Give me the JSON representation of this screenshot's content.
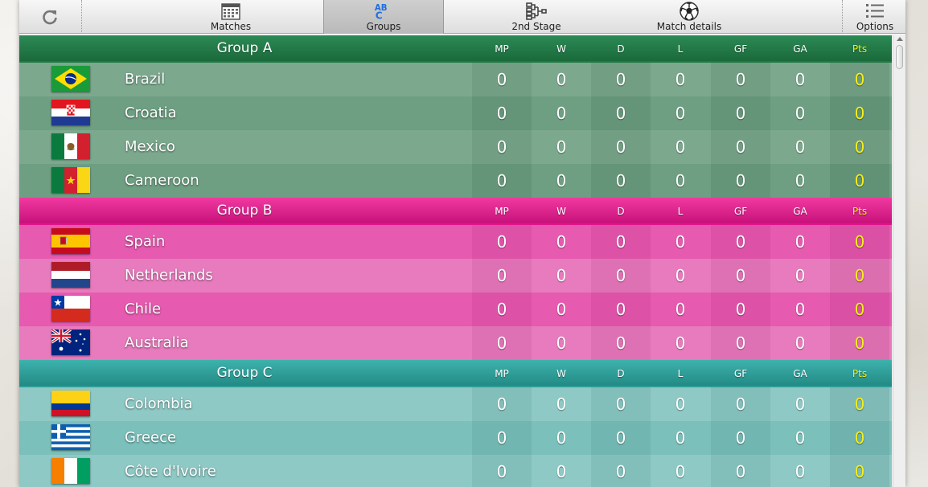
{
  "toolbar": {
    "items": [
      {
        "label": "",
        "icon": "refresh-icon"
      },
      {
        "label": "Matches",
        "icon": "calendar-icon"
      },
      {
        "label": "Groups",
        "icon": "abc-icon"
      },
      {
        "label": "2nd Stage",
        "icon": "bracket-icon"
      },
      {
        "label": "Match details",
        "icon": "soccer-ball-icon"
      },
      {
        "label": "Options",
        "icon": "list-icon"
      }
    ],
    "active": "Groups",
    "abc_text": "ABC"
  },
  "columns": [
    "MP",
    "W",
    "D",
    "L",
    "GF",
    "GA",
    "Pts"
  ],
  "colors": {
    "groupA": "#217a48",
    "groupB": "#e0168b",
    "groupC": "#2e9c97",
    "pts": "#f4ef1a"
  },
  "groups": [
    {
      "name": "Group A",
      "teams": [
        {
          "name": "Brazil",
          "flag": "brazil-flag",
          "MP": 0,
          "W": 0,
          "D": 0,
          "L": 0,
          "GF": 0,
          "GA": 0,
          "Pts": 0
        },
        {
          "name": "Croatia",
          "flag": "croatia-flag",
          "MP": 0,
          "W": 0,
          "D": 0,
          "L": 0,
          "GF": 0,
          "GA": 0,
          "Pts": 0
        },
        {
          "name": "Mexico",
          "flag": "mexico-flag",
          "MP": 0,
          "W": 0,
          "D": 0,
          "L": 0,
          "GF": 0,
          "GA": 0,
          "Pts": 0
        },
        {
          "name": "Cameroon",
          "flag": "cameroon-flag",
          "MP": 0,
          "W": 0,
          "D": 0,
          "L": 0,
          "GF": 0,
          "GA": 0,
          "Pts": 0
        }
      ]
    },
    {
      "name": "Group B",
      "teams": [
        {
          "name": "Spain",
          "flag": "spain-flag",
          "MP": 0,
          "W": 0,
          "D": 0,
          "L": 0,
          "GF": 0,
          "GA": 0,
          "Pts": 0
        },
        {
          "name": "Netherlands",
          "flag": "netherlands-flag",
          "MP": 0,
          "W": 0,
          "D": 0,
          "L": 0,
          "GF": 0,
          "GA": 0,
          "Pts": 0
        },
        {
          "name": "Chile",
          "flag": "chile-flag",
          "MP": 0,
          "W": 0,
          "D": 0,
          "L": 0,
          "GF": 0,
          "GA": 0,
          "Pts": 0
        },
        {
          "name": "Australia",
          "flag": "australia-flag",
          "MP": 0,
          "W": 0,
          "D": 0,
          "L": 0,
          "GF": 0,
          "GA": 0,
          "Pts": 0
        }
      ]
    },
    {
      "name": "Group C",
      "teams": [
        {
          "name": "Colombia",
          "flag": "colombia-flag",
          "MP": 0,
          "W": 0,
          "D": 0,
          "L": 0,
          "GF": 0,
          "GA": 0,
          "Pts": 0
        },
        {
          "name": "Greece",
          "flag": "greece-flag",
          "MP": 0,
          "W": 0,
          "D": 0,
          "L": 0,
          "GF": 0,
          "GA": 0,
          "Pts": 0
        },
        {
          "name": "Côte d'Ivoire",
          "flag": "cote-divoire-flag",
          "MP": 0,
          "W": 0,
          "D": 0,
          "L": 0,
          "GF": 0,
          "GA": 0,
          "Pts": 0
        }
      ]
    }
  ]
}
